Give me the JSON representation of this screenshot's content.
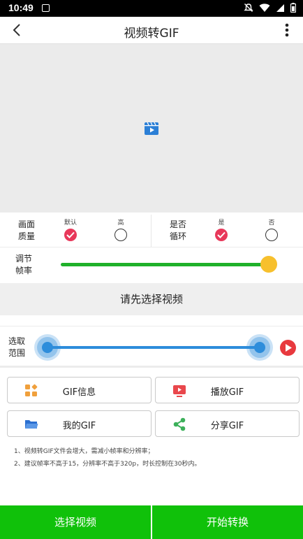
{
  "status_bar": {
    "time": "10:49"
  },
  "title_bar": {
    "title": "视频转GIF",
    "back_icon": "back-arrow-icon",
    "more_icon": "more-vertical-icon"
  },
  "preview": {
    "icon": "video-clip-icon"
  },
  "quality": {
    "label": [
      "画面",
      "质量"
    ],
    "options": [
      {
        "caption": "默认",
        "checked": true
      },
      {
        "caption": "高",
        "checked": false
      }
    ]
  },
  "loop": {
    "label": [
      "是否",
      "循环"
    ],
    "options": [
      {
        "caption": "是",
        "checked": true
      },
      {
        "caption": "否",
        "checked": false
      }
    ]
  },
  "frame_rate": {
    "label": [
      "调节",
      "帧率"
    ],
    "level_fraction": 1.0
  },
  "prompt": {
    "text": "请先选择视频"
  },
  "range": {
    "label": [
      "选取",
      "范围"
    ],
    "start_fraction": 0.0,
    "end_fraction": 1.0
  },
  "actions": {
    "gif_info": "GIF信息",
    "play_gif": "播放GIF",
    "my_gif": "我的GIF",
    "share_gif": "分享GIF"
  },
  "notes": [
    "1、视频转GIF文件会增大，需减小帧率和分辨率；",
    "2、建议帧率不高于15，分辨率不高于320p，时长控制在30秒内。"
  ],
  "bottom": {
    "select_video": "选择视频",
    "start_convert": "开始转换"
  },
  "colors": {
    "accent_green": "#10c10a",
    "slider_green": "#1fb12a",
    "knob_yellow": "#f7c02d",
    "range_blue": "#2d8ddb",
    "check_red": "#e8385a",
    "play_red": "#e8393e"
  }
}
